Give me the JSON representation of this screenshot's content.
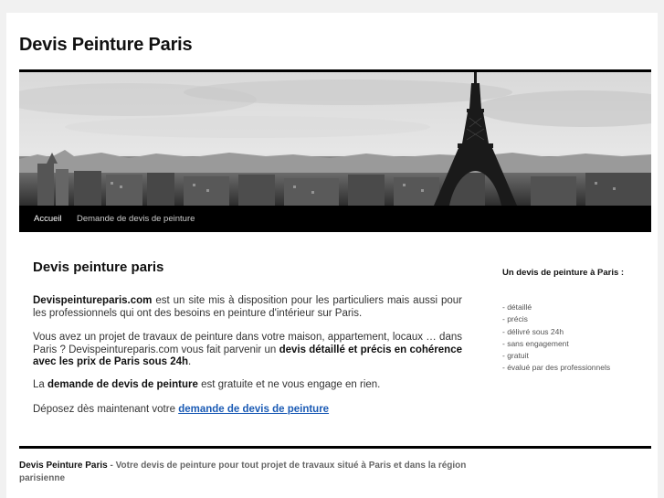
{
  "site": {
    "title": "Devis Peinture Paris"
  },
  "nav": {
    "items": [
      {
        "label": "Accueil",
        "active": true
      },
      {
        "label": "Demande de devis de peinture",
        "active": false
      }
    ]
  },
  "main": {
    "title": "Devis peinture paris",
    "p1": {
      "strong": "Devispeintureparis.com",
      "text": " est un site mis à disposition pour les particuliers mais aussi pour les professionnels qui ont des besoins en peinture d'intérieur sur Paris."
    },
    "p2": {
      "text1": "Vous avez un projet de travaux de peinture dans votre maison, appartement, locaux … dans Paris ? Devispeintureparis.com vous fait parvenir un ",
      "strong1": "devis détaillé et précis en cohérence avec les prix de Paris sous 24h",
      "text2": "."
    },
    "p3": {
      "text1": "La ",
      "strong": "demande de devis de peinture",
      "text2": " est gratuite et ne vous engage en rien."
    },
    "p4": {
      "text": "Déposez dès maintenant votre ",
      "link": "demande de devis de peinture"
    }
  },
  "sidebar": {
    "title": "Un devis de peinture à Paris :",
    "items": [
      "- détaillé",
      "- précis",
      "- délivré sous 24h",
      "- sans engagement",
      "- gratuit",
      "- évalué par des professionnels"
    ]
  },
  "footer": {
    "name": "Devis Peinture Paris",
    "text": " - Votre devis de peinture pour tout projet de travaux situé à Paris et dans la région parisienne"
  },
  "colors": {
    "link": "#1b5bb5",
    "navbar": "#000000",
    "page_bg": "#f1f1f1"
  }
}
